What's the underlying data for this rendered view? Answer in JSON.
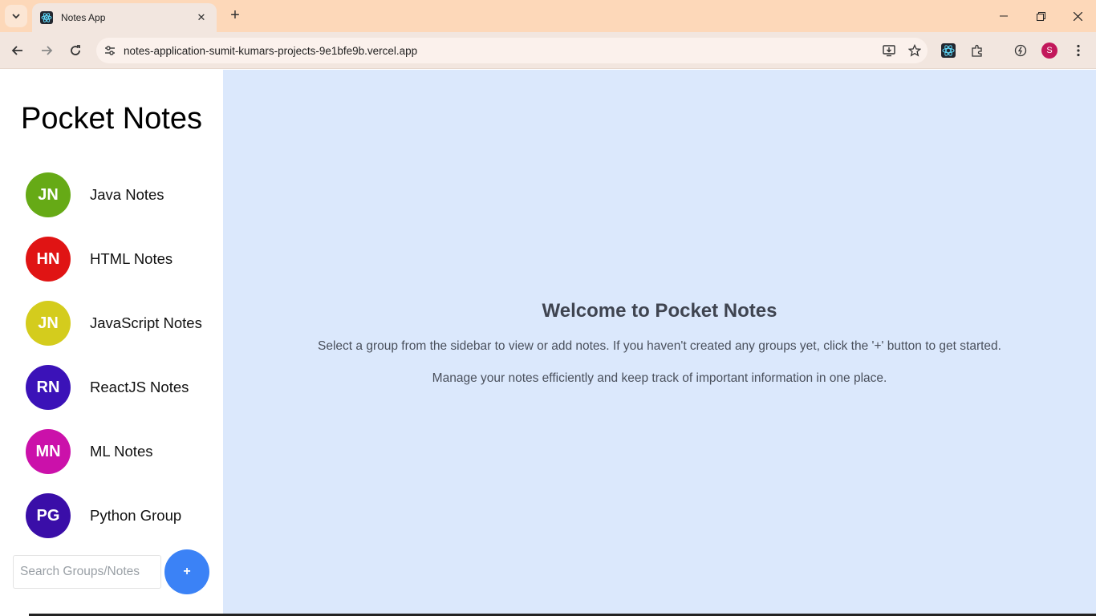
{
  "browser": {
    "tab_title": "Notes App",
    "url": "notes-application-sumit-kumars-projects-9e1bfe9b.vercel.app",
    "profile_initial": "S",
    "icons": [
      "tab-search-icon",
      "react-favicon-icon",
      "close-icon",
      "new-tab-icon",
      "minimize-icon",
      "restore-icon",
      "close-window-icon",
      "back-icon",
      "forward-icon",
      "reload-icon",
      "site-info-icon",
      "install-app-icon",
      "bookmark-star-icon",
      "react-devtools-icon",
      "extensions-icon",
      "performance-icon",
      "menu-icon"
    ]
  },
  "sidebar": {
    "title": "Pocket Notes",
    "groups": [
      {
        "initials": "JN",
        "name": "Java Notes",
        "color": "#66aa16"
      },
      {
        "initials": "HN",
        "name": "HTML Notes",
        "color": "#e01414"
      },
      {
        "initials": "JN",
        "name": "JavaScript Notes",
        "color": "#d4cc1d"
      },
      {
        "initials": "RN",
        "name": "ReactJS Notes",
        "color": "#3b12b8"
      },
      {
        "initials": "MN",
        "name": "ML Notes",
        "color": "#cb11aa"
      },
      {
        "initials": "PG",
        "name": "Python Group",
        "color": "#3a0ea8"
      }
    ],
    "search_placeholder": "Search Groups/Notes",
    "add_button_label": "+"
  },
  "main": {
    "heading": "Welcome to Pocket Notes",
    "line1": "Select a group from the sidebar to view or add notes. If you haven't created any groups yet, click the '+' button to get started.",
    "line2": "Manage your notes efficiently and keep track of important information in one place."
  },
  "colors": {
    "main_bg": "#dbe8fc",
    "add_button": "#3b82f6",
    "tabstrip": "#fdd8b9"
  }
}
